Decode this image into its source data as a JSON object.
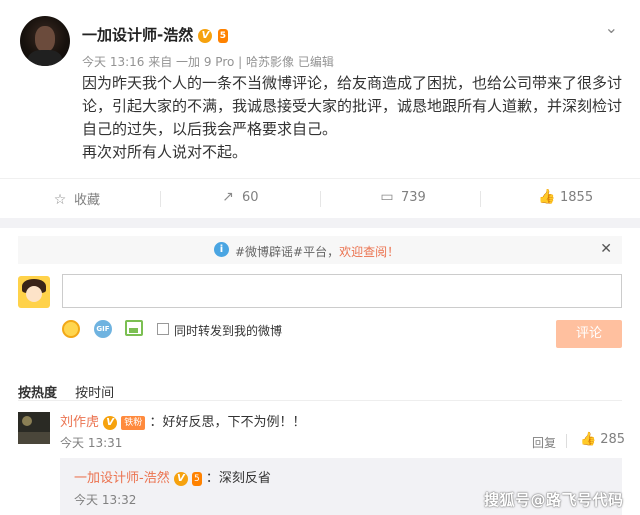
{
  "post": {
    "author": "一加设计师-浩然",
    "verified_badge": "V",
    "level_badge": "5",
    "meta": "今天 13:16 来自 一加 9 Pro | 哈苏影像   已编辑",
    "content": "因为昨天我个人的一条不当微博评论，给友商造成了困扰，也给公司带来了很多讨论，引起大家的不满，我诚恳接受大家的批评，诚恳地跟所有人道歉，并深刻检讨自己的过失，以后我会严格要求自己。",
    "content2": "再次对所有人说对不起。",
    "more_icon": "chevron-down-icon"
  },
  "actions": {
    "favorite": {
      "label": "收藏",
      "icon": "star-icon"
    },
    "repost": {
      "count": "60",
      "icon": "repost-icon"
    },
    "comment": {
      "count": "739",
      "icon": "comment-icon"
    },
    "like": {
      "count": "1855",
      "icon": "thumbs-up-icon"
    }
  },
  "notice": {
    "prefix": "#微博辟谣#平台，",
    "link": "欢迎查阅！",
    "close": "✕"
  },
  "composer": {
    "placeholder": "",
    "sync_label": "同时转发到我的微博",
    "submit_label": "评论",
    "gif_label": "GIF"
  },
  "sort": {
    "hot": "按热度",
    "time": "按时间"
  },
  "comment": {
    "name": "刘作虎",
    "fan_badge": "铁粉",
    "text": "：好好反思，下不为例！！",
    "time": "今天 13:31",
    "reply_label": "回复",
    "likes": "285"
  },
  "reply": {
    "name": "一加设计师-浩然",
    "text": "：深刻反省",
    "time": "今天 13:32"
  },
  "watermark": "搜狐号@路飞号代码",
  "colors": {
    "accent": "#eb7350",
    "submit_disabled": "#ffc09f",
    "badge_orange": "#ff8200",
    "info_blue": "#4aa5e2"
  }
}
